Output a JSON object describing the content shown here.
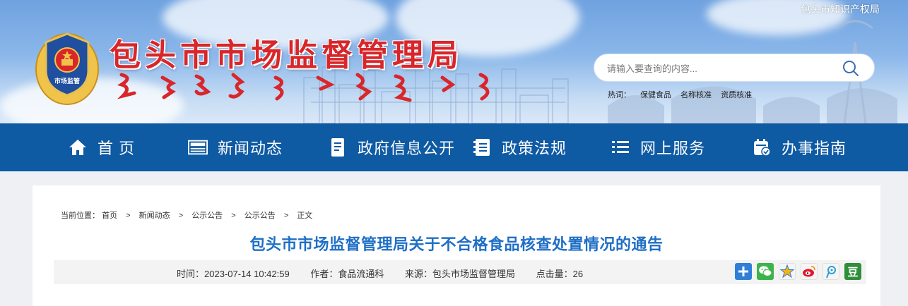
{
  "header": {
    "site_title": "包头市市场监督管理局",
    "emblem_text": "市场监管",
    "top_link": "包头市知识产权局",
    "search_placeholder": "请输入要查询的内容...",
    "hotwords_label": "热词：",
    "hotwords": [
      "保健食品",
      "名称核准",
      "资质核准"
    ]
  },
  "nav": {
    "items": [
      {
        "label": "首 页",
        "icon": "home-icon"
      },
      {
        "label": "新闻动态",
        "icon": "news-icon"
      },
      {
        "label": "政府信息公开",
        "icon": "document-icon"
      },
      {
        "label": "政策法规",
        "icon": "book-icon"
      },
      {
        "label": "网上服务",
        "icon": "list-icon"
      },
      {
        "label": "办事指南",
        "icon": "calendar-check-icon"
      }
    ]
  },
  "breadcrumb": {
    "label": "当前位置：",
    "items": [
      "首页",
      "新闻动态",
      "公示公告",
      "公示公告",
      "正文"
    ],
    "separator": ">"
  },
  "article": {
    "title": "包头市市场监督管理局关于不合格食品核查处置情况的通告",
    "time": "时间：2023-07-14 10:42:59",
    "author": "作者：食品流通科",
    "source": "来源：包头市场监督管理局",
    "clicks": "点击量：26"
  },
  "share": {
    "buttons": [
      "share-more-icon",
      "wechat-icon",
      "qzone-icon",
      "weibo-icon",
      "tencent-weibo-icon",
      "douban-icon"
    ],
    "douban_glyph": "豆"
  },
  "colors": {
    "nav_bg": "#0e5aa3",
    "title_red": "#d8262a",
    "article_title_blue": "#1f6fc5"
  }
}
